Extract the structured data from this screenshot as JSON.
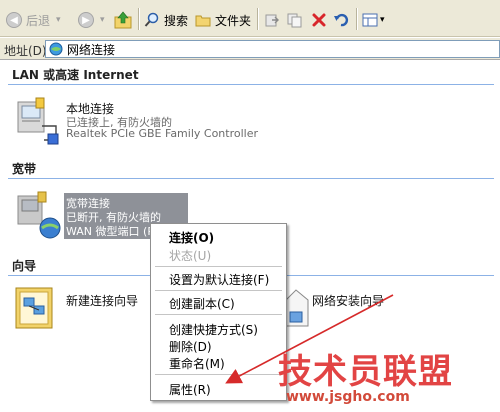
{
  "toolbar": {
    "back_label": "后退",
    "search_label": "搜索",
    "folders_label": "文件夹"
  },
  "address": {
    "label": "地址(D)",
    "value": "网络连接"
  },
  "sections": {
    "lan": {
      "title": "LAN 或高速 Internet",
      "connection": {
        "name": "本地连接",
        "status": "已连接上, 有防火墙的",
        "device": "Realtek PCIe GBE Family Controller"
      }
    },
    "broadband": {
      "title": "宽带",
      "connection": {
        "name": "宽带连接",
        "status": "已断开, 有防火墙的",
        "device": "WAN 微型端口 (P"
      }
    },
    "wizard": {
      "title": "向导",
      "new_connection": "新建连接向导",
      "network_setup": "网络安装向导"
    }
  },
  "context_menu": {
    "items": [
      {
        "label": "连接(O)",
        "bold": true
      },
      {
        "label": "状态(U)",
        "disabled": true
      },
      {
        "label": "设置为默认连接(F)"
      },
      {
        "label": "创建副本(C)"
      },
      {
        "label": "创建快捷方式(S)"
      },
      {
        "label": "删除(D)"
      },
      {
        "label": "重命名(M)"
      },
      {
        "label": "属性(R)"
      }
    ]
  },
  "watermark": {
    "title": "技术员联盟",
    "url": "www.jsgho.com"
  },
  "colors": {
    "toolbar_bg": "#ece9d8",
    "selection_bg": "#8e9198",
    "divider": "#8cb2e6",
    "watermark_red": "#e24444"
  }
}
